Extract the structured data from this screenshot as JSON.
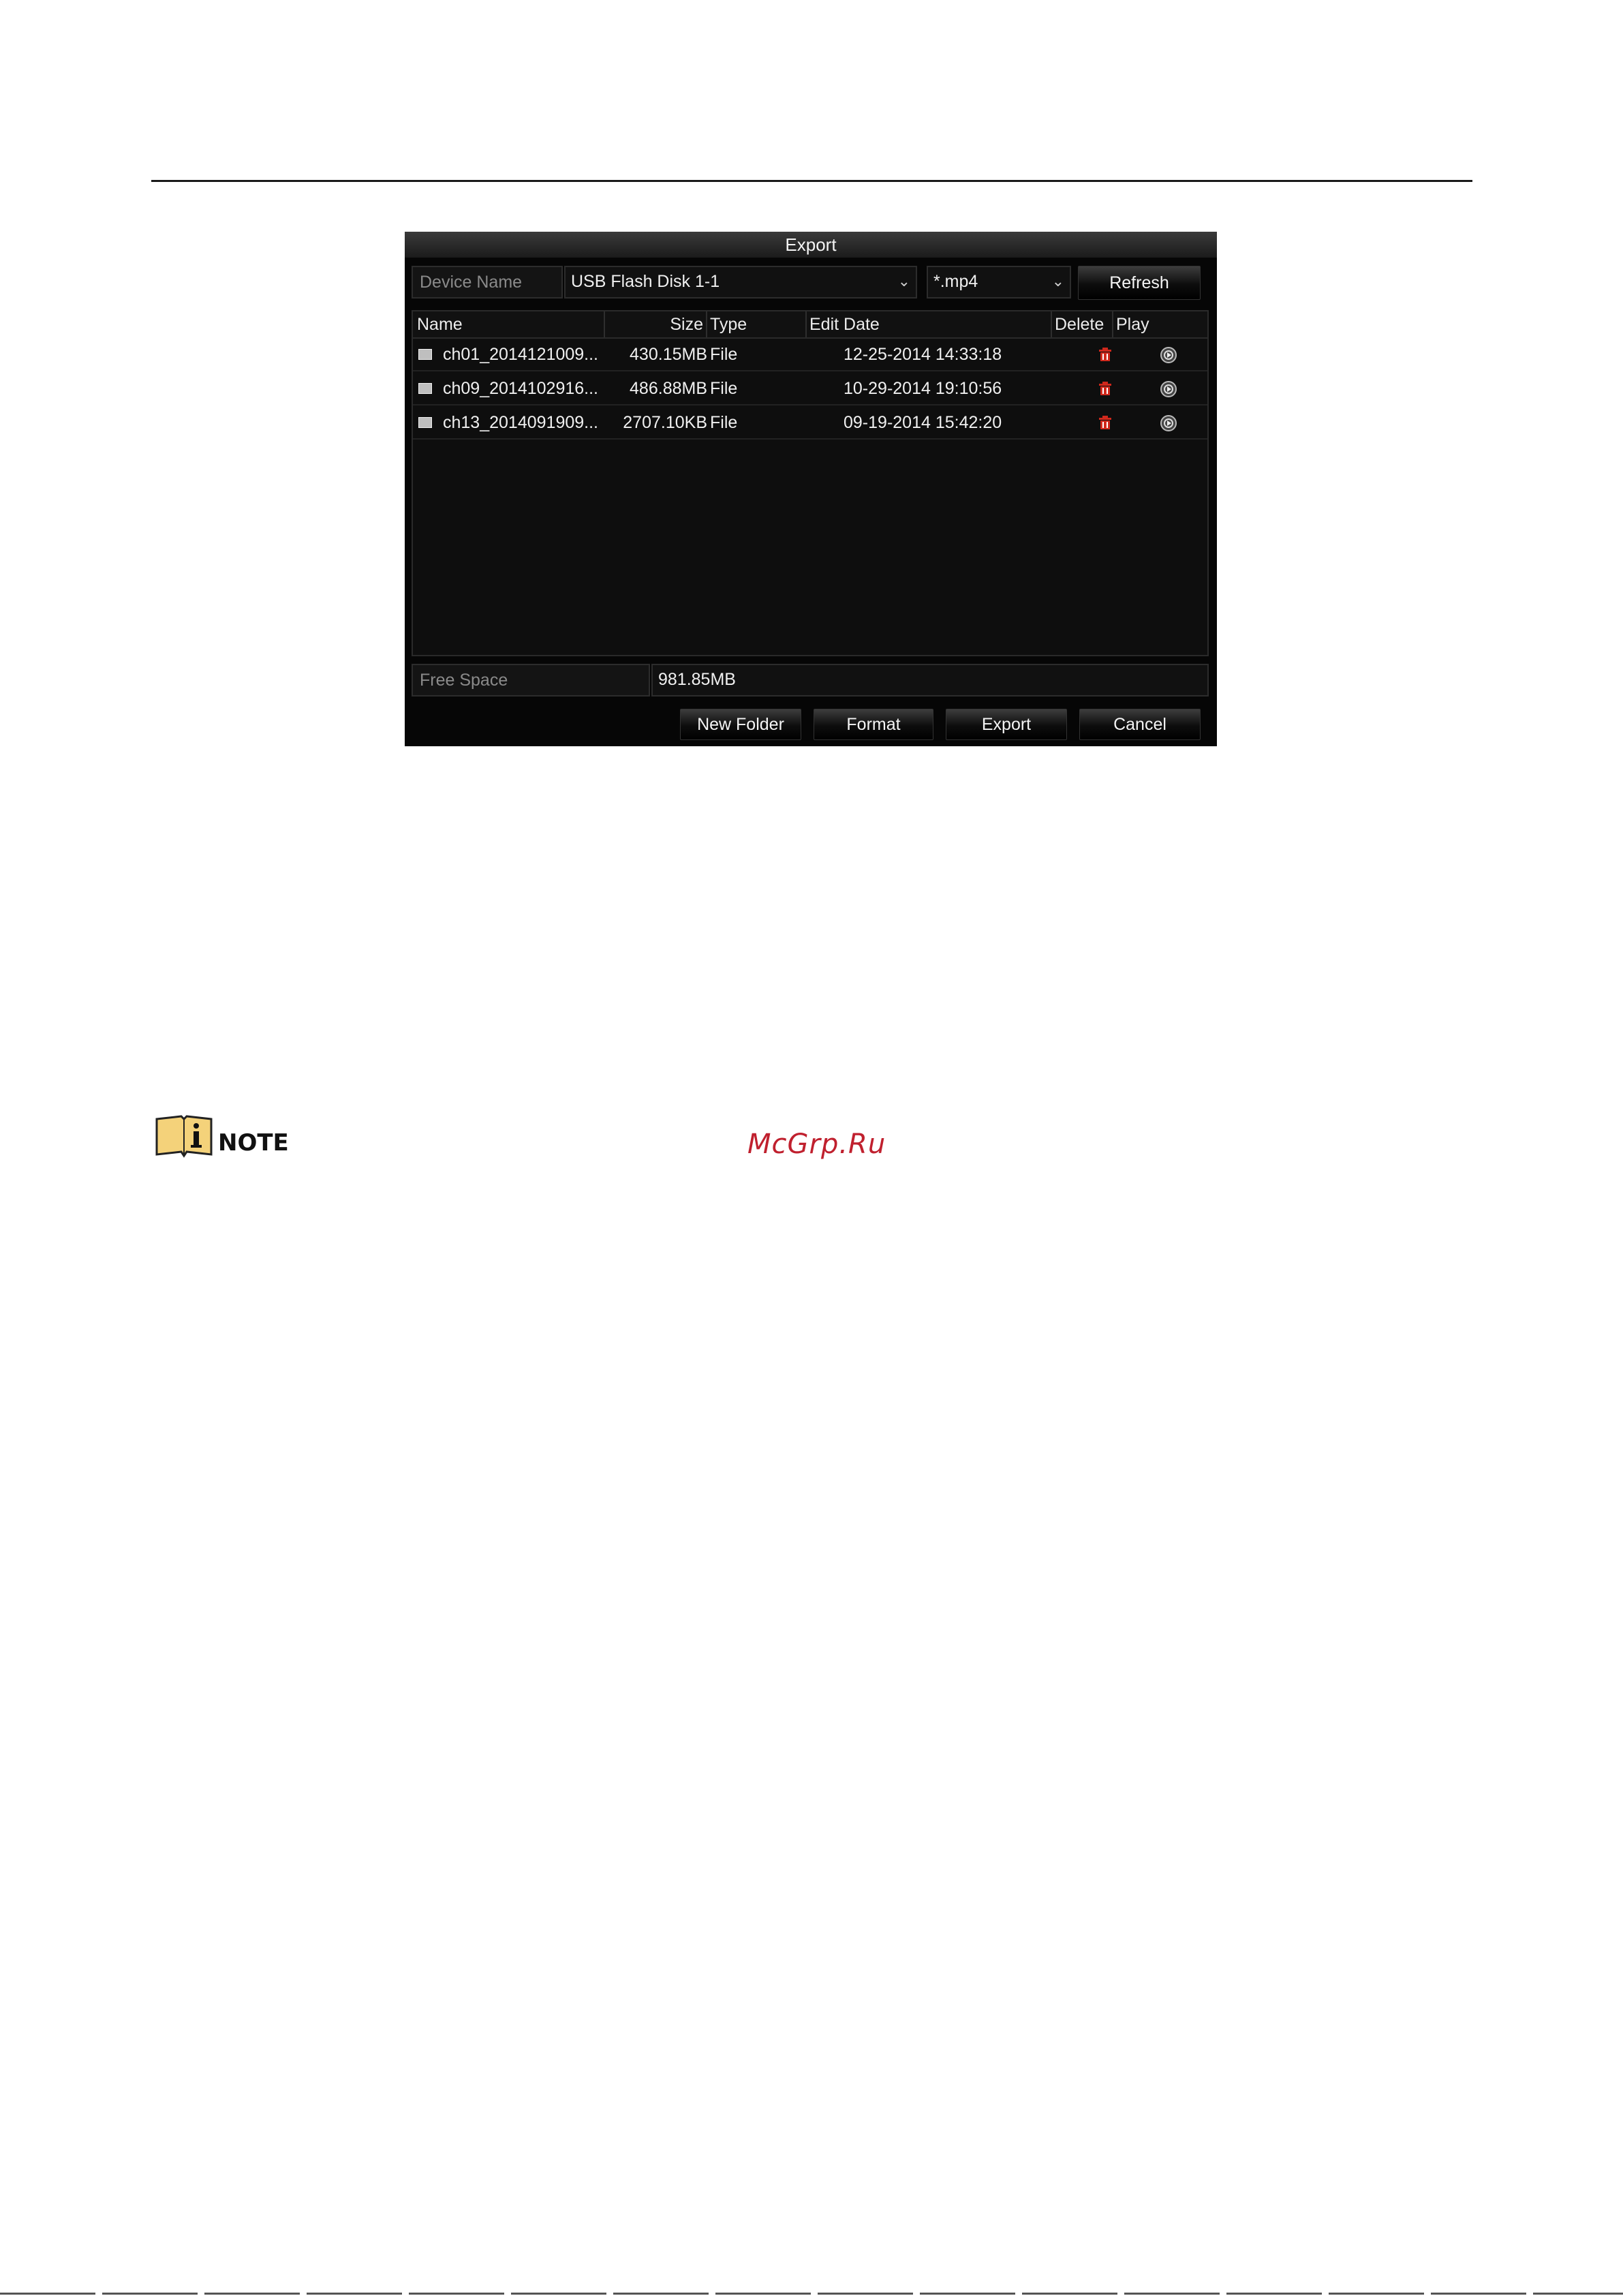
{
  "dialog": {
    "title": "Export",
    "device_name_label": "Device Name",
    "device_name_value": "USB Flash Disk 1-1",
    "file_type_value": "*.mp4",
    "refresh_label": "Refresh",
    "columns": {
      "name": "Name",
      "size": "Size",
      "type": "Type",
      "edit_date": "Edit Date",
      "delete": "Delete",
      "play": "Play"
    },
    "files": [
      {
        "name": "ch01_2014121009...",
        "size": "430.15MB",
        "type": "File",
        "edit_date": "12-25-2014 14:33:18"
      },
      {
        "name": "ch09_2014102916...",
        "size": "486.88MB",
        "type": "File",
        "edit_date": "10-29-2014 19:10:56"
      },
      {
        "name": "ch13_2014091909...",
        "size": "2707.10KB",
        "type": "File",
        "edit_date": "09-19-2014 15:42:20"
      }
    ],
    "free_space_label": "Free Space",
    "free_space_value": "981.85MB",
    "buttons": {
      "new_folder": "New Folder",
      "format": "Format",
      "export": "Export",
      "cancel": "Cancel"
    }
  },
  "note": {
    "label": "NOTE",
    "icon": "info-book-icon"
  },
  "watermark": "McGrp.Ru",
  "colors": {
    "delete_icon": "#d0281c",
    "note_icon_fill": "#f4d27a",
    "watermark": "#c0202e"
  }
}
